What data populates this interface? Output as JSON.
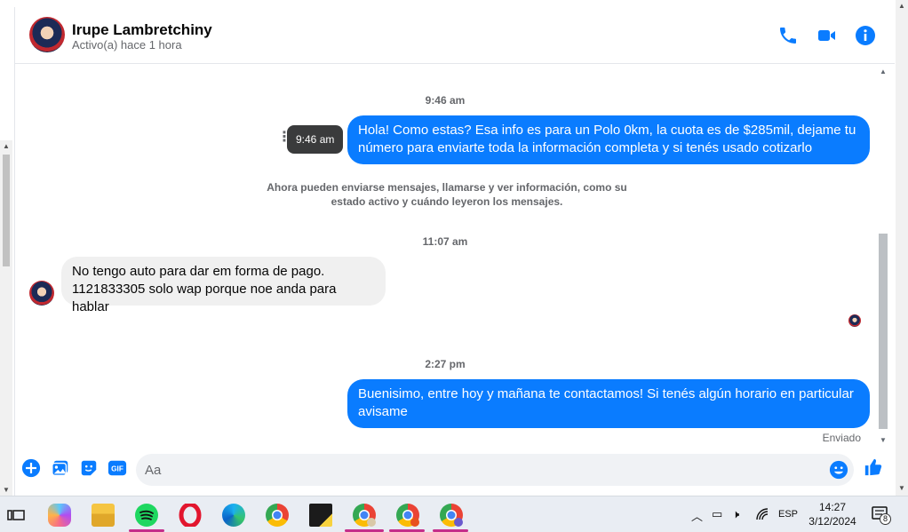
{
  "header": {
    "name": "Irupe Lambretchiny",
    "status": "Activo(a) hace 1 hora",
    "icons": [
      "phone-icon",
      "video-camera-icon",
      "info-icon"
    ]
  },
  "messages": {
    "time_1": "9:46 am",
    "tooltip_time": "9:46 am",
    "out_1": "Hola! Como estas? Esa info es para un Polo 0km, la cuota es de $285mil, dejame tu número para enviarte toda la información completa y si tenés usado cotizarlo",
    "system_notice": "Ahora pueden enviarse mensajes, llamarse y ver información, como su estado activo y cuándo leyeron los mensajes.",
    "time_2": "11:07 am",
    "in_1_line1": "No tengo auto para dar em forma de pago.",
    "in_1_line2": "1121833305 solo wap porque noe anda para hablar",
    "time_3": "2:27 pm",
    "out_2": "Buenisimo, entre hoy y mañana te contactamos! Si tenés algún horario en particular avisame",
    "sent_label": "Enviado"
  },
  "composer": {
    "placeholder": "Aa",
    "icons": [
      "add-icon",
      "photo-icon",
      "sticker-icon",
      "gif-icon",
      "emoji-icon",
      "like-icon"
    ],
    "gif_label": "GIF"
  },
  "taskbar": {
    "apps": [
      "task-view-icon",
      "copilot-icon",
      "file-explorer-icon",
      "spotify-icon",
      "opera-icon",
      "edge-icon",
      "chrome-icon",
      "sticky-notes-icon",
      "chrome-profile-1-icon",
      "chrome-profile-2-icon",
      "chrome-profile-3-icon"
    ],
    "language": "ESP",
    "time": "14:27",
    "date": "3/12/2024",
    "notification_count": "8"
  },
  "colors": {
    "accent": "#0a7cff",
    "incoming_bubble": "#f0f0f0",
    "taskbar_bg": "#e9edf3"
  }
}
